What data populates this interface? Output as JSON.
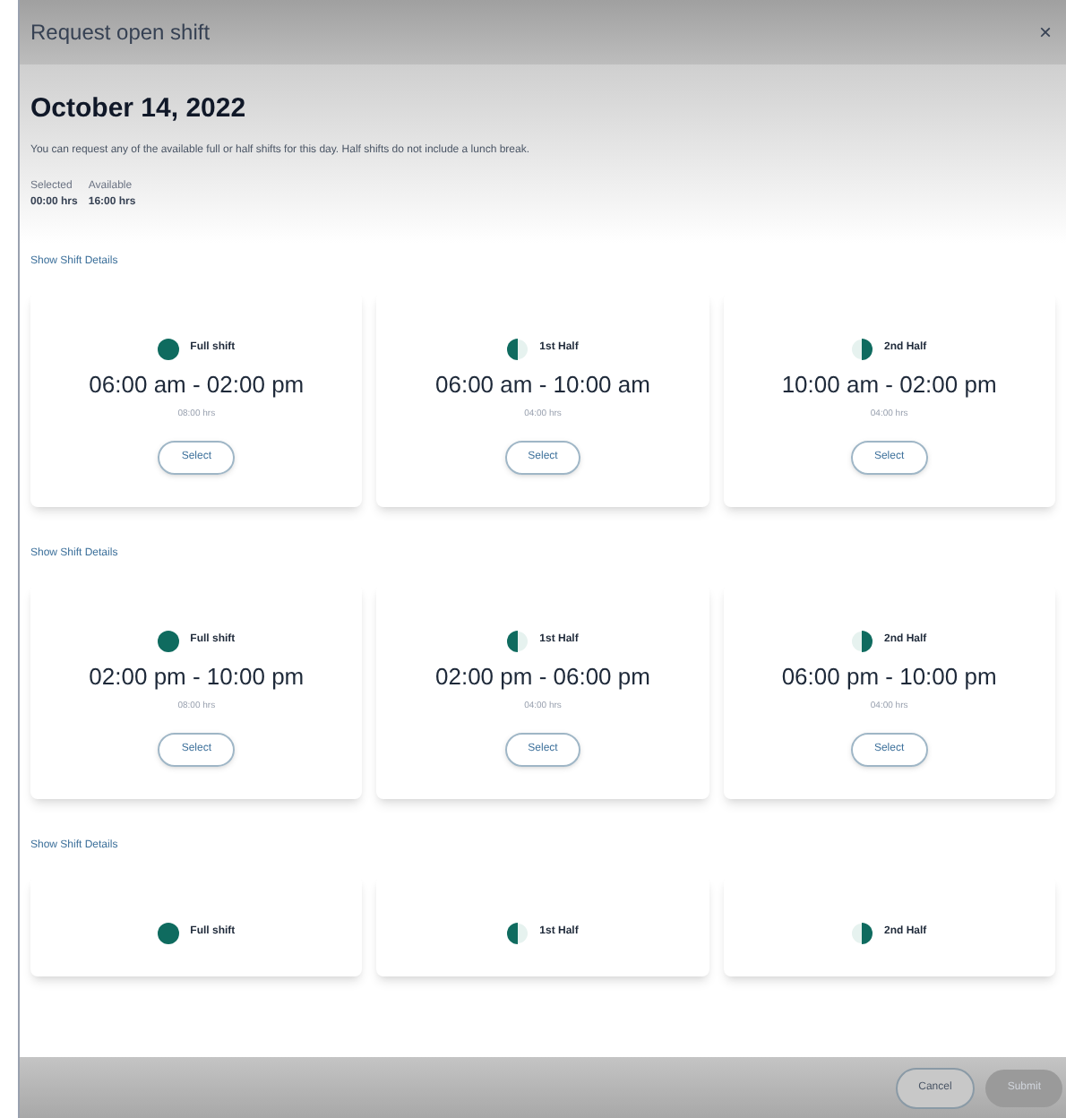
{
  "dialog": {
    "title": "Request open shift",
    "close": "×"
  },
  "date": "October 14, 2022",
  "description": "You can request any of the available full or half shifts for this day. Half shifts do not include a lunch break.",
  "summary": [
    {
      "label": "Selected",
      "value": "00:00 hrs"
    },
    {
      "label": "Available",
      "value": "16:00 hrs"
    }
  ],
  "groups": [
    {
      "link": "Show Shift Details",
      "shifts": [
        {
          "kind": "full",
          "label": "Full shift",
          "time": "06:00 am - 02:00 pm",
          "hours": "08:00 hrs",
          "button": "Select"
        },
        {
          "kind": "first_half",
          "label": "1st Half",
          "time": "06:00 am - 10:00 am",
          "hours": "04:00 hrs",
          "button": "Select"
        },
        {
          "kind": "second_half",
          "label": "2nd Half",
          "time": "10:00 am - 02:00 pm",
          "hours": "04:00 hrs",
          "button": "Select"
        }
      ]
    },
    {
      "link": "Show Shift Details",
      "shifts": [
        {
          "kind": "full",
          "label": "Full shift",
          "time": "02:00 pm - 10:00 pm",
          "hours": "08:00 hrs",
          "button": "Select"
        },
        {
          "kind": "first_half",
          "label": "1st Half",
          "time": "02:00 pm - 06:00 pm",
          "hours": "04:00 hrs",
          "button": "Select"
        },
        {
          "kind": "second_half",
          "label": "2nd Half",
          "time": "06:00 pm - 10:00 pm",
          "hours": "04:00 hrs",
          "button": "Select"
        }
      ]
    },
    {
      "link": "Show Shift Details",
      "shifts": [
        {
          "kind": "full",
          "label": "Full shift"
        },
        {
          "kind": "first_half",
          "label": "1st Half"
        },
        {
          "kind": "second_half",
          "label": "2nd Half"
        }
      ]
    }
  ],
  "footer": [
    {
      "label": "Cancel",
      "disabled": false
    },
    {
      "label": "Submit",
      "disabled": true
    }
  ]
}
